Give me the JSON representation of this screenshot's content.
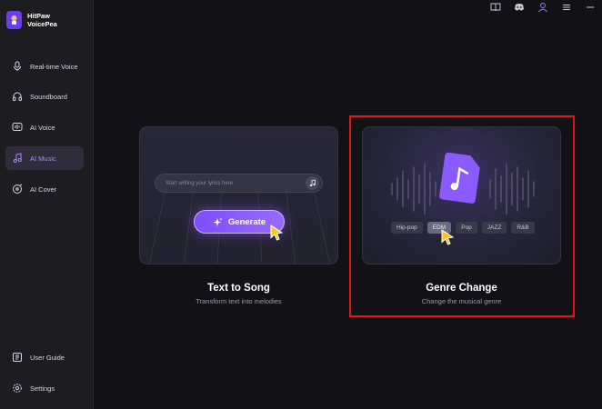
{
  "app": {
    "name_line1": "HitPaw",
    "name_line2": "VoicePea"
  },
  "sidebar": {
    "items": [
      {
        "label": "Real-time Voice",
        "icon": "microphone-icon"
      },
      {
        "label": "Soundboard",
        "icon": "headphones-icon"
      },
      {
        "label": "AI Voice",
        "icon": "ai-voice-icon"
      },
      {
        "label": "AI Music",
        "icon": "music-note-icon",
        "active": true
      },
      {
        "label": "AI Cover",
        "icon": "vinyl-icon"
      }
    ],
    "bottom": [
      {
        "label": "User Guide",
        "icon": "book-icon"
      },
      {
        "label": "Settings",
        "icon": "gear-icon"
      }
    ]
  },
  "topbar": [
    "book-icon",
    "discord-icon",
    "user-icon",
    "menu-icon",
    "minimize-icon"
  ],
  "cards": {
    "text_to_song": {
      "title": "Text to Song",
      "subtitle": "Transform text into melodies",
      "placeholder": "Start writing your lyrics here",
      "button": "Generate"
    },
    "genre_change": {
      "title": "Genre Change",
      "subtitle": "Change the musical genre",
      "genres": [
        "Hip-pop",
        "EDM",
        "Pop",
        "JAZZ",
        "R&B"
      ],
      "selected": "EDM"
    }
  },
  "colors": {
    "accent": "#7c4dff",
    "active_text": "#a78bfa",
    "highlight": "#e4141b"
  }
}
